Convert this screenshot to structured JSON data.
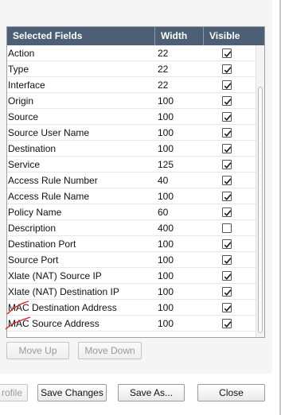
{
  "table": {
    "headers": {
      "field": "Selected Fields",
      "width": "Width",
      "visible": "Visible"
    },
    "rows": [
      {
        "field": "Action",
        "width": "22",
        "visible": true
      },
      {
        "field": "Type",
        "width": "22",
        "visible": true
      },
      {
        "field": "Interface",
        "width": "22",
        "visible": true
      },
      {
        "field": "Origin",
        "width": "100",
        "visible": true
      },
      {
        "field": "Source",
        "width": "100",
        "visible": true
      },
      {
        "field": "Source User Name",
        "width": "100",
        "visible": true
      },
      {
        "field": "Destination",
        "width": "100",
        "visible": true
      },
      {
        "field": "Service",
        "width": "125",
        "visible": true
      },
      {
        "field": "Access Rule Number",
        "width": "40",
        "visible": true
      },
      {
        "field": "Access Rule Name",
        "width": "100",
        "visible": true
      },
      {
        "field": "Policy Name",
        "width": "60",
        "visible": true
      },
      {
        "field": "Description",
        "width": "400",
        "visible": false
      },
      {
        "field": "Destination Port",
        "width": "100",
        "visible": true
      },
      {
        "field": "Source Port",
        "width": "100",
        "visible": true
      },
      {
        "field": "Xlate (NAT) Source IP",
        "width": "100",
        "visible": true
      },
      {
        "field": "Xlate (NAT) Destination IP",
        "width": "100",
        "visible": true
      },
      {
        "field": "MAC Destination Address",
        "width": "100",
        "visible": true
      },
      {
        "field": "MAC Source Address",
        "width": "100",
        "visible": true
      }
    ]
  },
  "buttons": {
    "move_up": "Move Up",
    "move_down": "Move Down",
    "profile": "rofile",
    "save_changes": "Save Changes",
    "save_as": "Save As...",
    "close": "Close"
  },
  "colors": {
    "header_bg": "#4d5f74",
    "annotation_red": "#e02020"
  }
}
